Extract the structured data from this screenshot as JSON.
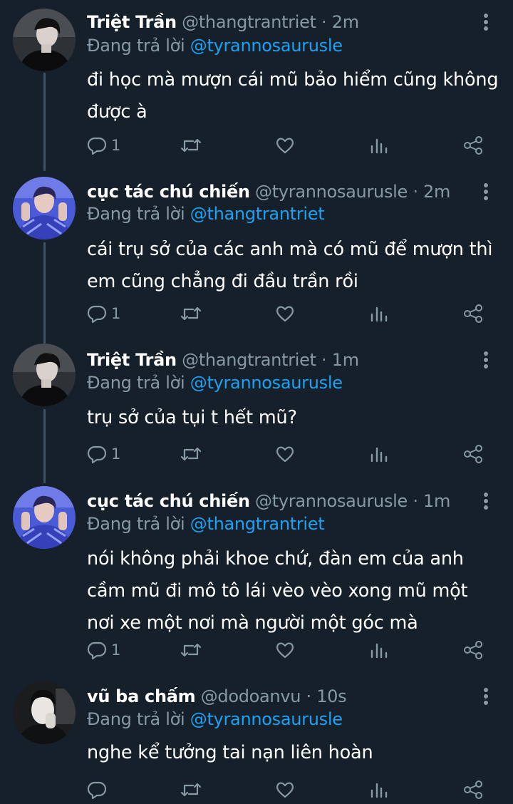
{
  "thread": [
    {
      "display_name": "Triệt Trần",
      "handle": "@thangtrantriet",
      "separator": "·",
      "time": "2m",
      "replying_label": "Đang trả lời",
      "replying_to": "@tyrannosaurusle",
      "text": "đi học mà mượn cái mũ bảo hiểm cũng không được à",
      "reply_count": "1",
      "avatar_icon": "dark-portrait-avatar"
    },
    {
      "display_name": "cục tác chú chiến",
      "handle": "@tyrannosaurusle",
      "separator": "·",
      "time": "2m",
      "replying_label": "Đang trả lời",
      "replying_to": "@thangtrantriet",
      "text": "cái trụ sở của các anh mà có mũ để mượn thì em cũng chẳng đi đầu trần rồi",
      "reply_count": "1",
      "avatar_icon": "blue-portrait-avatar"
    },
    {
      "display_name": "Triệt Trần",
      "handle": "@thangtrantriet",
      "separator": "·",
      "time": "1m",
      "replying_label": "Đang trả lời",
      "replying_to": "@tyrannosaurusle",
      "text": "trụ sở của tụi t hết mũ?",
      "reply_count": "1",
      "avatar_icon": "dark-portrait-avatar"
    },
    {
      "display_name": "cục tác chú chiến",
      "handle": "@tyrannosaurusle",
      "separator": "·",
      "time": "1m",
      "replying_label": "Đang trả lời",
      "replying_to": "@thangtrantriet",
      "text": "nói không phải khoe chứ, đàn em của anh cầm mũ đi mô tô lái vèo vèo xong mũ một nơi xe một nơi mà người một góc mà",
      "reply_count": "1",
      "avatar_icon": "blue-portrait-avatar"
    },
    {
      "display_name": "vũ ba chấm",
      "handle": "@dodoanvu",
      "separator": "·",
      "time": "10s",
      "replying_label": "Đang trả lời",
      "replying_to": "@tyrannosaurusle",
      "text": "nghe kể tưởng tai nạn liên hoàn",
      "reply_count": "",
      "avatar_icon": "bw-portrait-avatar"
    }
  ],
  "colors": {
    "background": "#15202b",
    "text_primary": "#ffffff",
    "text_secondary": "#8899a6",
    "mention": "#1da1f2",
    "thread_line": "#3d5466"
  }
}
